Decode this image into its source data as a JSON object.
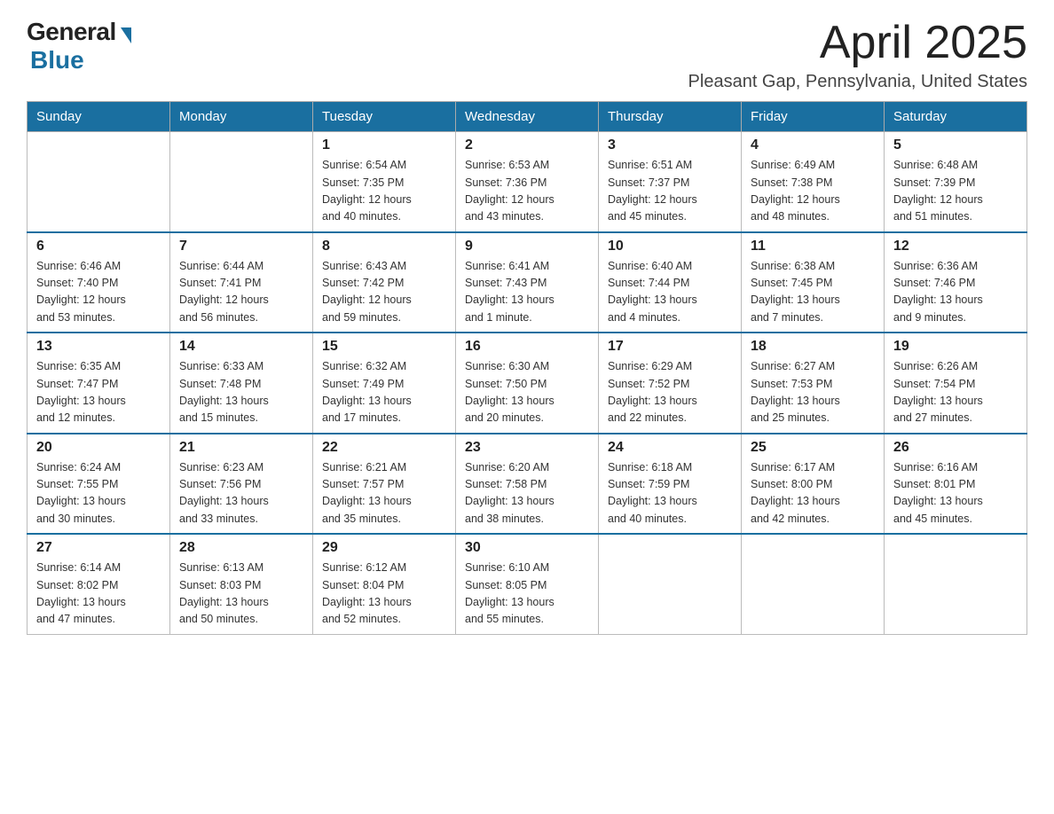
{
  "header": {
    "logo_general": "General",
    "logo_blue": "Blue",
    "month": "April 2025",
    "location": "Pleasant Gap, Pennsylvania, United States"
  },
  "weekdays": [
    "Sunday",
    "Monday",
    "Tuesday",
    "Wednesday",
    "Thursday",
    "Friday",
    "Saturday"
  ],
  "weeks": [
    [
      {
        "day": "",
        "info": ""
      },
      {
        "day": "",
        "info": ""
      },
      {
        "day": "1",
        "info": "Sunrise: 6:54 AM\nSunset: 7:35 PM\nDaylight: 12 hours\nand 40 minutes."
      },
      {
        "day": "2",
        "info": "Sunrise: 6:53 AM\nSunset: 7:36 PM\nDaylight: 12 hours\nand 43 minutes."
      },
      {
        "day": "3",
        "info": "Sunrise: 6:51 AM\nSunset: 7:37 PM\nDaylight: 12 hours\nand 45 minutes."
      },
      {
        "day": "4",
        "info": "Sunrise: 6:49 AM\nSunset: 7:38 PM\nDaylight: 12 hours\nand 48 minutes."
      },
      {
        "day": "5",
        "info": "Sunrise: 6:48 AM\nSunset: 7:39 PM\nDaylight: 12 hours\nand 51 minutes."
      }
    ],
    [
      {
        "day": "6",
        "info": "Sunrise: 6:46 AM\nSunset: 7:40 PM\nDaylight: 12 hours\nand 53 minutes."
      },
      {
        "day": "7",
        "info": "Sunrise: 6:44 AM\nSunset: 7:41 PM\nDaylight: 12 hours\nand 56 minutes."
      },
      {
        "day": "8",
        "info": "Sunrise: 6:43 AM\nSunset: 7:42 PM\nDaylight: 12 hours\nand 59 minutes."
      },
      {
        "day": "9",
        "info": "Sunrise: 6:41 AM\nSunset: 7:43 PM\nDaylight: 13 hours\nand 1 minute."
      },
      {
        "day": "10",
        "info": "Sunrise: 6:40 AM\nSunset: 7:44 PM\nDaylight: 13 hours\nand 4 minutes."
      },
      {
        "day": "11",
        "info": "Sunrise: 6:38 AM\nSunset: 7:45 PM\nDaylight: 13 hours\nand 7 minutes."
      },
      {
        "day": "12",
        "info": "Sunrise: 6:36 AM\nSunset: 7:46 PM\nDaylight: 13 hours\nand 9 minutes."
      }
    ],
    [
      {
        "day": "13",
        "info": "Sunrise: 6:35 AM\nSunset: 7:47 PM\nDaylight: 13 hours\nand 12 minutes."
      },
      {
        "day": "14",
        "info": "Sunrise: 6:33 AM\nSunset: 7:48 PM\nDaylight: 13 hours\nand 15 minutes."
      },
      {
        "day": "15",
        "info": "Sunrise: 6:32 AM\nSunset: 7:49 PM\nDaylight: 13 hours\nand 17 minutes."
      },
      {
        "day": "16",
        "info": "Sunrise: 6:30 AM\nSunset: 7:50 PM\nDaylight: 13 hours\nand 20 minutes."
      },
      {
        "day": "17",
        "info": "Sunrise: 6:29 AM\nSunset: 7:52 PM\nDaylight: 13 hours\nand 22 minutes."
      },
      {
        "day": "18",
        "info": "Sunrise: 6:27 AM\nSunset: 7:53 PM\nDaylight: 13 hours\nand 25 minutes."
      },
      {
        "day": "19",
        "info": "Sunrise: 6:26 AM\nSunset: 7:54 PM\nDaylight: 13 hours\nand 27 minutes."
      }
    ],
    [
      {
        "day": "20",
        "info": "Sunrise: 6:24 AM\nSunset: 7:55 PM\nDaylight: 13 hours\nand 30 minutes."
      },
      {
        "day": "21",
        "info": "Sunrise: 6:23 AM\nSunset: 7:56 PM\nDaylight: 13 hours\nand 33 minutes."
      },
      {
        "day": "22",
        "info": "Sunrise: 6:21 AM\nSunset: 7:57 PM\nDaylight: 13 hours\nand 35 minutes."
      },
      {
        "day": "23",
        "info": "Sunrise: 6:20 AM\nSunset: 7:58 PM\nDaylight: 13 hours\nand 38 minutes."
      },
      {
        "day": "24",
        "info": "Sunrise: 6:18 AM\nSunset: 7:59 PM\nDaylight: 13 hours\nand 40 minutes."
      },
      {
        "day": "25",
        "info": "Sunrise: 6:17 AM\nSunset: 8:00 PM\nDaylight: 13 hours\nand 42 minutes."
      },
      {
        "day": "26",
        "info": "Sunrise: 6:16 AM\nSunset: 8:01 PM\nDaylight: 13 hours\nand 45 minutes."
      }
    ],
    [
      {
        "day": "27",
        "info": "Sunrise: 6:14 AM\nSunset: 8:02 PM\nDaylight: 13 hours\nand 47 minutes."
      },
      {
        "day": "28",
        "info": "Sunrise: 6:13 AM\nSunset: 8:03 PM\nDaylight: 13 hours\nand 50 minutes."
      },
      {
        "day": "29",
        "info": "Sunrise: 6:12 AM\nSunset: 8:04 PM\nDaylight: 13 hours\nand 52 minutes."
      },
      {
        "day": "30",
        "info": "Sunrise: 6:10 AM\nSunset: 8:05 PM\nDaylight: 13 hours\nand 55 minutes."
      },
      {
        "day": "",
        "info": ""
      },
      {
        "day": "",
        "info": ""
      },
      {
        "day": "",
        "info": ""
      }
    ]
  ]
}
